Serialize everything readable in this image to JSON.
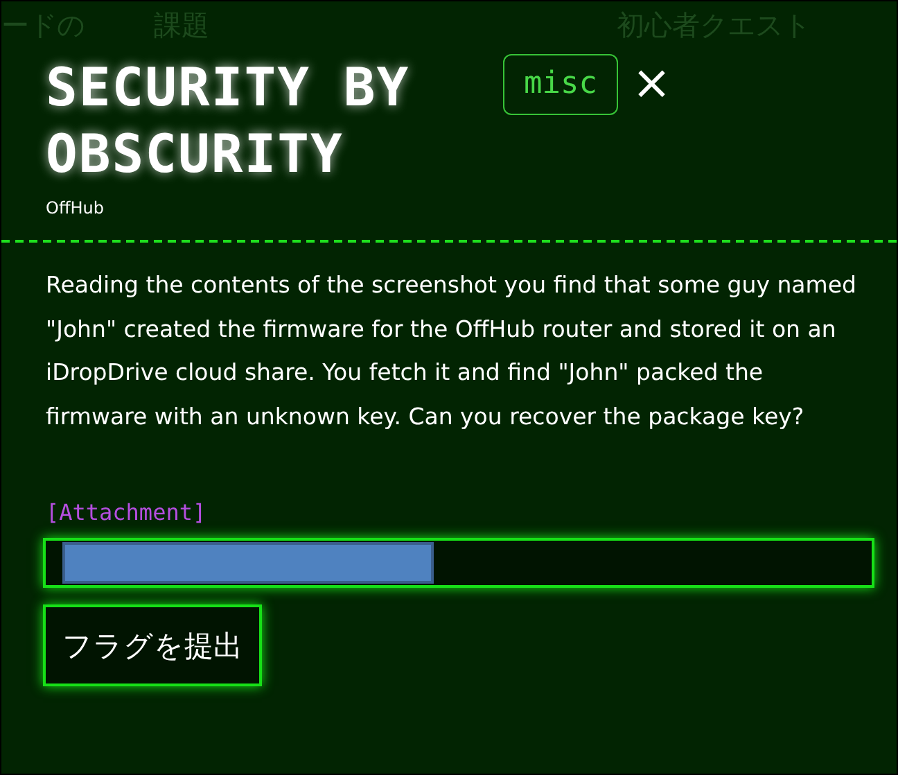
{
  "background_nav": [
    {
      "label": "ードの"
    },
    {
      "label": "課題"
    },
    {
      "label": "初心者クエスト"
    }
  ],
  "modal": {
    "title": "SECURITY BY OBSCURITY",
    "author": "OffHub",
    "tag": "misc",
    "close": "×",
    "description": "Reading the contents of the screenshot you find that some guy named \"John\" created the firmware for the OffHub router and stored it on an iDropDrive cloud share. You fetch it and find \"John\" packed the firmware with an unknown key. Can you recover the package key?",
    "attachment": "[Attachment]",
    "flag_field": {
      "highlighted": true
    },
    "submit": "フラグを提出"
  }
}
